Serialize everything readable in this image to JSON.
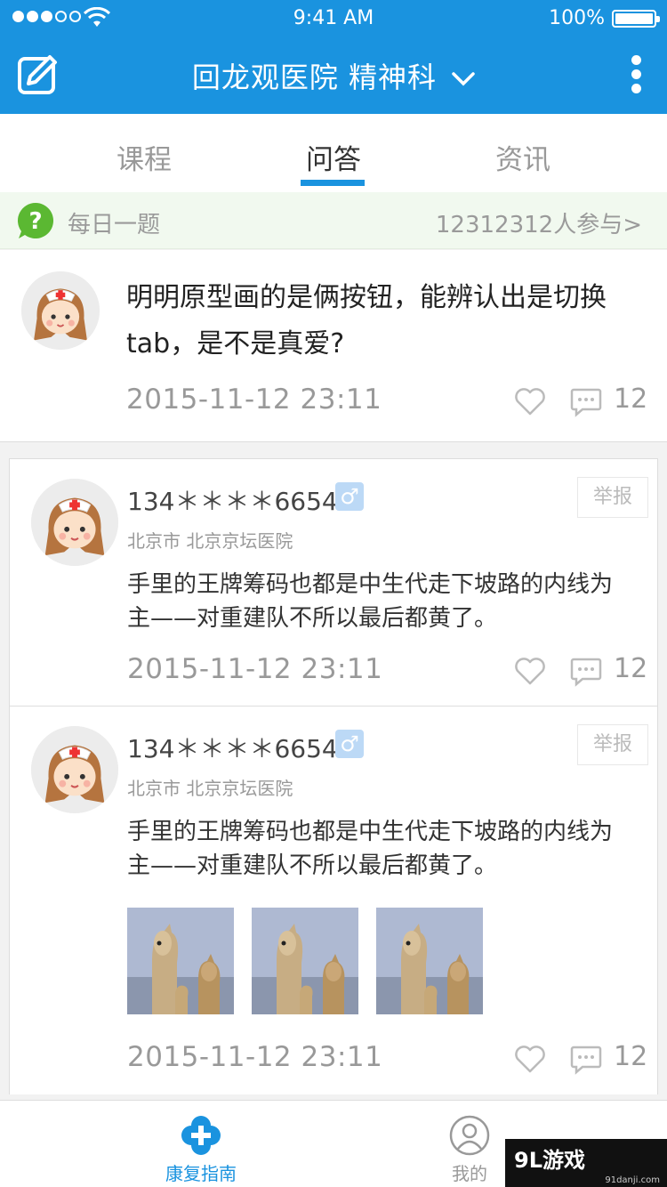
{
  "status_bar": {
    "time": "9:41 AM",
    "battery": "100%"
  },
  "header": {
    "title": "回龙观医院 精神科"
  },
  "tabs": [
    {
      "label": "课程"
    },
    {
      "label": "问答"
    },
    {
      "label": "资讯"
    }
  ],
  "daily": {
    "label": "每日一题",
    "count": "12312312人参与>"
  },
  "question": {
    "text": "明明原型画的是俩按钮，能辨认出是切换tab，是不是真爱?",
    "time": "2015-11-12 23:11",
    "comment_count": "12"
  },
  "answers": [
    {
      "name": "134＊＊＊＊6654",
      "gender": "♂",
      "location": "北京市  北京京坛医院",
      "report": "举报",
      "text": "手里的王牌筹码也都是中生代走下坡路的内线为主——对重建队不所以最后都黄了。",
      "time": "2015-11-12 23:11",
      "comment_count": "12"
    },
    {
      "name": "134＊＊＊＊6654",
      "gender": "♂",
      "location": "北京市  北京京坛医院",
      "report": "举报",
      "text": "手里的王牌筹码也都是中生代走下坡路的内线为主——对重建队不所以最后都黄了。",
      "time": "2015-11-12 23:11",
      "comment_count": "12"
    }
  ],
  "bottom_nav": [
    {
      "label": "康复指南"
    },
    {
      "label": "我的"
    }
  ],
  "watermark": {
    "main": "9L游戏",
    "sub": "91danji.com"
  }
}
